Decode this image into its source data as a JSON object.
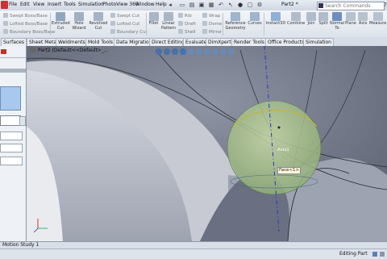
{
  "menubar": {
    "items": [
      "File",
      "Edit",
      "View",
      "Insert",
      "Tools",
      "Simulation",
      "PhotoView 360",
      "Window",
      "Help"
    ],
    "doc_title": "Part2 *",
    "search_placeholder": "Search Commands"
  },
  "commands": {
    "features_small": [
      "Swept Boss/Base",
      "Lofted Boss/Base",
      "Boundary Boss/Base"
    ],
    "large": [
      "Extruded Cut",
      "Hole Wizard",
      "Revolved Cut"
    ],
    "cut_small": [
      "Swept Cut",
      "Lofted Cut",
      "Boundary Cut"
    ],
    "fillet_group": [
      "Fillet",
      "Linear Pattern"
    ],
    "ref_small": [
      "Rib",
      "Draft",
      "Shell"
    ],
    "wrap_small": [
      "Wrap",
      "Dome",
      "Mirror"
    ],
    "right_large": [
      "Reference Geometry",
      "Curves",
      "Instant3D",
      "Combine",
      "Join",
      "Split",
      "Normal To",
      "Plane",
      "Axis",
      "Measure"
    ]
  },
  "tabs": [
    "Surfaces",
    "Sheet Metal",
    "Weldments",
    "Mold Tools",
    "Data Migration",
    "Direct Editing",
    "Evaluate",
    "DimXpert",
    "Render Tools",
    "Office Products",
    "Simulation"
  ],
  "viewport": {
    "tree_label": "Part2 (Default<<Default>_...",
    "face_callout": "Face<1>",
    "axis_callout": "Axis1"
  },
  "bottom": {
    "motion_tab": "Motion Study 1",
    "status": "Editing Part"
  },
  "colors": {
    "sphere": "#a8c488",
    "axis": "#2233cc",
    "accent": "#3d6fb6"
  }
}
